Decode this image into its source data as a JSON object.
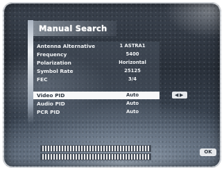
{
  "title": "Manual Search",
  "rows": [
    {
      "label": "Antenna Alternative",
      "value": "1 ASTRA1"
    },
    {
      "label": "Frequency",
      "value": "5400"
    },
    {
      "label": "Polarization",
      "value": "Horizontal"
    },
    {
      "label": "Symbol Rate",
      "value": "25125"
    },
    {
      "label": "FEC",
      "value": "3/4"
    },
    {
      "label": "Video PID",
      "value": "Auto"
    },
    {
      "label": "Audio PID",
      "value": "Auto"
    },
    {
      "label": "PCR PID",
      "value": "Auto"
    }
  ],
  "selected_row": "Video PID",
  "nav_arrows": {
    "left": "◀",
    "right": "▶"
  },
  "signal_meters": [
    {
      "name": "signal-level"
    },
    {
      "name": "signal-quality"
    }
  ],
  "ok_badge": "OK",
  "colors": {
    "selected_bg": "#f7f8f9",
    "text": "#f2f4f6",
    "selected_text": "#2e3640"
  }
}
